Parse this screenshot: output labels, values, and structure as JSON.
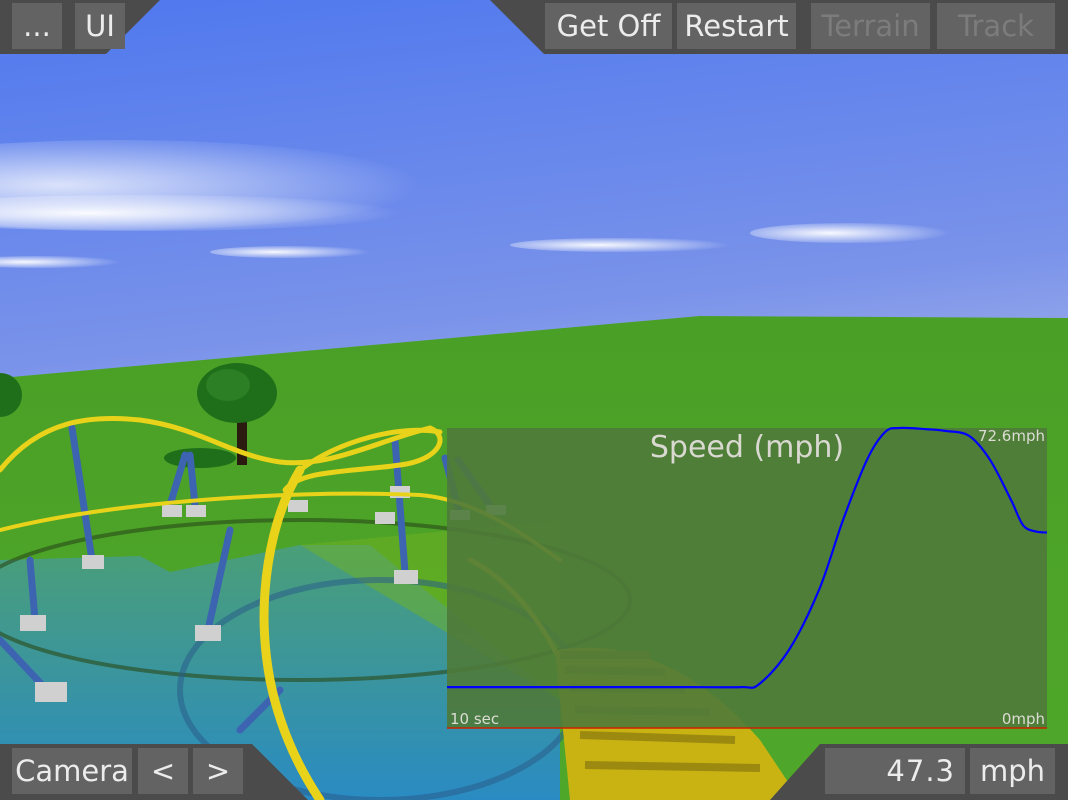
{
  "toolbar_top_left": {
    "menu_label": "...",
    "ui_label": "UI"
  },
  "toolbar_top_right": {
    "get_off_label": "Get Off",
    "restart_label": "Restart",
    "terrain_label": "Terrain",
    "track_label": "Track",
    "terrain_enabled": false,
    "track_enabled": false
  },
  "toolbar_bottom_left": {
    "camera_label": "Camera",
    "prev_label": "<",
    "next_label": ">"
  },
  "speed_readout": {
    "value": "47.3",
    "unit_label": "mph"
  },
  "colors": {
    "toolbar_bg": "#4b4b4b",
    "button_bg": "#636363",
    "button_text": "#ececec",
    "button_text_disabled": "#7c7c7c",
    "chart_line": "#0000ff",
    "chart_baseline": "#cc2200",
    "chart_panel": "#4f7a3a"
  },
  "chart_data": {
    "type": "line",
    "title": "Speed (mph)",
    "xlabel": "10 sec",
    "ymax_label": "72.6mph",
    "ymin_label": "0mph",
    "xlim": [
      0,
      10
    ],
    "ylim": [
      0,
      72.6
    ],
    "grid": false,
    "legend": "none",
    "series": [
      {
        "name": "Speed",
        "x": [
          0,
          1,
          2,
          3,
          4,
          4.9,
          5.2,
          5.7,
          6.2,
          6.6,
          7.0,
          7.3,
          7.55,
          8.0,
          8.3,
          8.7,
          9.05,
          9.4,
          9.6,
          9.8,
          10
        ],
        "y": [
          9.9,
          9.9,
          9.9,
          9.9,
          9.9,
          9.9,
          10.6,
          18.9,
          33.4,
          50.3,
          64.9,
          71.6,
          72.6,
          72.3,
          71.9,
          70.7,
          64.9,
          55.2,
          49.1,
          47.6,
          47.3
        ]
      }
    ]
  }
}
